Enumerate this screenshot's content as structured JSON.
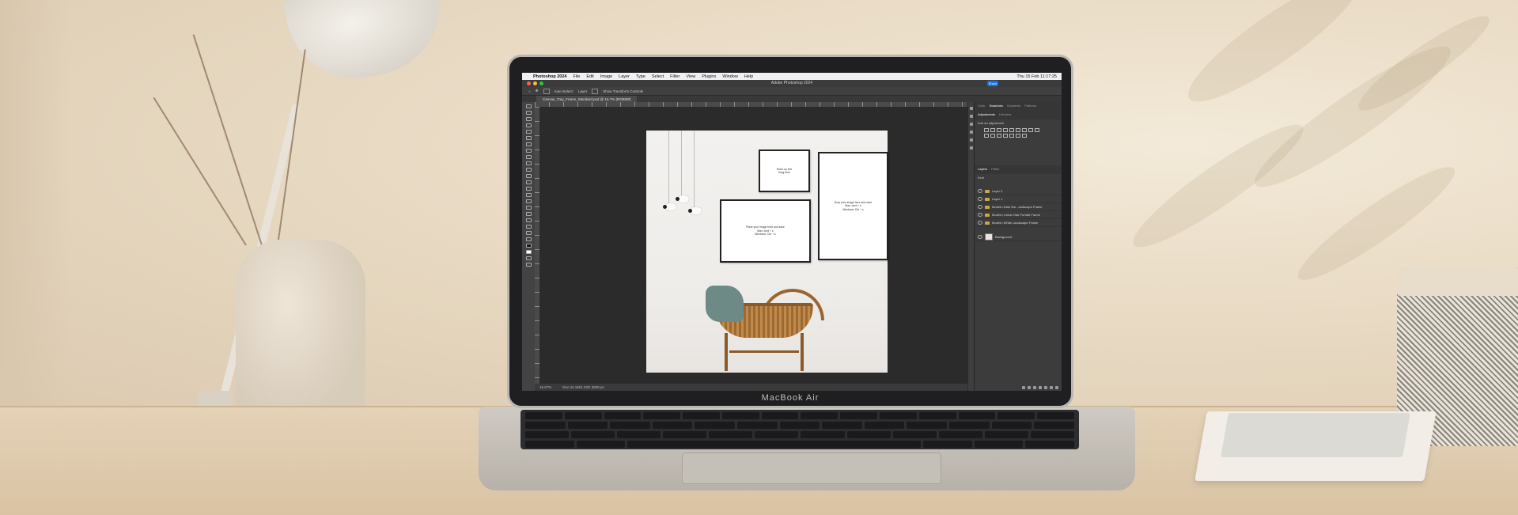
{
  "photoshop": {
    "menubar": {
      "app_name": "Photoshop 2024",
      "items": [
        "File",
        "Edit",
        "Image",
        "Layer",
        "Type",
        "Select",
        "Filter",
        "View",
        "Plugins",
        "Window",
        "Help"
      ],
      "clock": "Thu 15 Feb  11:17:25"
    },
    "window_title": "Adobe Photoshop 2024",
    "share_label": "Share",
    "options_bar": {
      "auto_select": "Auto-Select:",
      "layer_select": "Layer",
      "transform_controls": "Show Transform Controls"
    },
    "doc_tab": "Canvas_Tray_Frame_Standard.psd @ 16.7% (RGB/8#)",
    "status": {
      "zoom": "16.67%",
      "doc_info": "Doc:44.1M/1.03G 3608 px"
    },
    "frames": {
      "small": [
        "Mock-up text",
        "Drag here"
      ],
      "landscape": [
        "Place your image here and save",
        "Mac: cmd + s",
        "Windows: Ctrl + s"
      ],
      "tall": [
        "Drop your image here and save",
        "Mac: cmd + s",
        "Windows: Ctrl + s"
      ]
    },
    "right_panel": {
      "top_tabs": [
        "Color",
        "Swatches",
        "Gradients",
        "Patterns"
      ],
      "adjust_tabs": [
        "Adjustments",
        "Libraries"
      ],
      "adjust_hint": "Add an adjustment",
      "layer_tabs": [
        "Layers",
        "Paths"
      ],
      "kind_label": "Kind",
      "layers": [
        "Layer 2",
        "Layer 1",
        "Modern Dark Wo...andscape Frame",
        "Modern Linear Oak Portrait Frame",
        "Modern White Landscape Frame"
      ],
      "background_layer": "Background"
    }
  },
  "laptop": {
    "brand": "MacBook Air"
  }
}
